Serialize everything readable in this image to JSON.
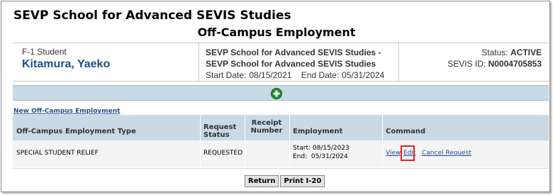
{
  "header": {
    "school_title": "SEVP School for Advanced SEVIS Studies",
    "page_heading": "Off-Campus Employment"
  },
  "student": {
    "type": "F-1 Student",
    "name": "Kitamura, Yaeko"
  },
  "program": {
    "line1": "SEVP School for Advanced SEVIS Studies -",
    "line2": "SEVP School for Advanced SEVIS Studies",
    "start_label": "Start Date:",
    "start_date": "08/15/2021",
    "end_label": "End Date:",
    "end_date": "05/31/2024"
  },
  "status": {
    "status_label": "Status:",
    "status_value": "ACTIVE",
    "sevis_label": "SEVIS ID:",
    "sevis_value": "N0004705853"
  },
  "employment": {
    "new_link": "New Off-Campus Employment",
    "columns": [
      "Off-Campus Employment Type",
      "Request Status",
      "Receipt Number",
      "Employment",
      "Command"
    ],
    "rows": [
      {
        "type": "SPECIAL STUDENT RELIEF",
        "request_status": "REQUESTED",
        "receipt_number": "",
        "start": "Start: 08/15/2023",
        "end": "End:  05/31/2024",
        "view_label": "View",
        "edit_label": "Edit",
        "cancel_label": "Cancel Request"
      }
    ]
  },
  "footer": {
    "return_label": "Return",
    "print_label": "Print I-20"
  },
  "colors": {
    "bar": "#c9d9e6",
    "link": "#1f4e8c",
    "highlight": "#e32222",
    "add_icon": "#1e8c2e"
  }
}
